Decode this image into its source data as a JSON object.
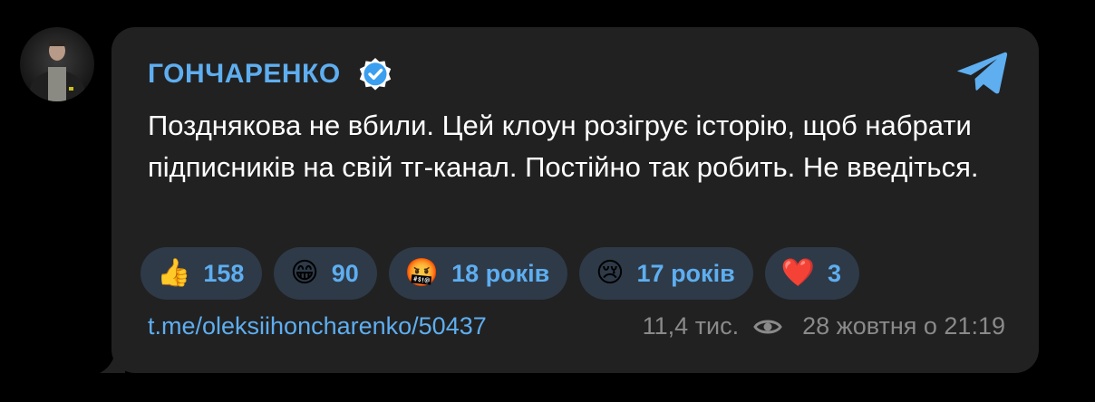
{
  "channel": {
    "name": "ГОНЧАРЕНКО",
    "verified_icon": "verified-badge-icon",
    "logo_icon": "telegram-icon"
  },
  "post": {
    "text": "Позднякова не вбили. Цей клоун розігрує історію, щоб набрати підписників на свій тг-канал. Постійно так робить. Не введіться.",
    "link": "t.me/oleksiihoncharenko/50437",
    "views": "11,4 тис.",
    "views_icon": "eye-icon",
    "date": "28 жовтня о 21:19"
  },
  "reactions": [
    {
      "emoji": "👍",
      "count": "158"
    },
    {
      "emoji": "😁",
      "count": "90"
    },
    {
      "emoji": "🤬",
      "count": "18 років"
    },
    {
      "emoji": "😢",
      "count": "17 років"
    },
    {
      "emoji": "❤️",
      "count": "3"
    }
  ],
  "colors": {
    "background": "#000000",
    "bubble": "#212121",
    "accent": "#5eaef0",
    "reaction_bg": "#2e3a48",
    "meta_text": "#8a8a8a"
  }
}
